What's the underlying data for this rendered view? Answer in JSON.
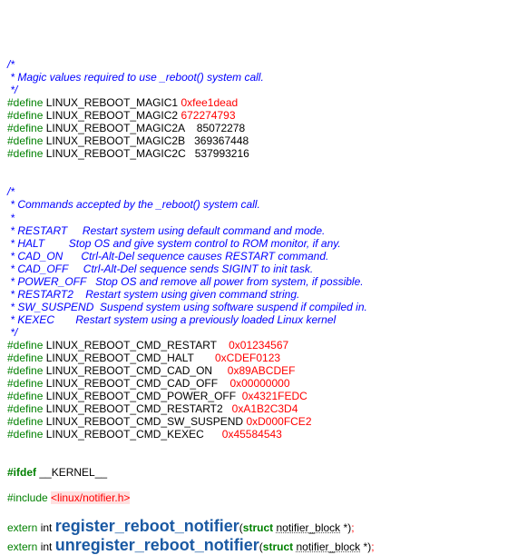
{
  "block1": {
    "c1": "/*",
    "c2": " * Magic values required to use _reboot() system call.",
    "c3": " */"
  },
  "defs1": [
    {
      "kw": "#define",
      "name": "LINUX_REBOOT_MAGIC1",
      "val": "0xfee1dead",
      "cls": "hex"
    },
    {
      "kw": "#define",
      "name": "LINUX_REBOOT_MAGIC2",
      "val": "672274793",
      "cls": "hex"
    },
    {
      "kw": "#define",
      "name": "LINUX_REBOOT_MAGIC2A    85072278",
      "val": "",
      "cls": "num"
    },
    {
      "kw": "#define",
      "name": "LINUX_REBOOT_MAGIC2B   369367448",
      "val": "",
      "cls": "num"
    },
    {
      "kw": "#define",
      "name": "LINUX_REBOOT_MAGIC2C   537993216",
      "val": "",
      "cls": "num"
    }
  ],
  "block2": {
    "c1": "/*",
    "c2": " * Commands accepted by the _reboot() system call.",
    "c3": " *",
    "c4": " * RESTART     Restart system using default command and mode.",
    "c5": " * HALT        Stop OS and give system control to ROM monitor, if any.",
    "c6": " * CAD_ON      Ctrl-Alt-Del sequence causes RESTART command.",
    "c7": " * CAD_OFF     Ctrl-Alt-Del sequence sends SIGINT to init task.",
    "c8": " * POWER_OFF   Stop OS and remove all power from system, if possible.",
    "c9": " * RESTART2    Restart system using given command string.",
    "c10": " * SW_SUSPEND  Suspend system using software suspend if compiled in.",
    "c11": " * KEXEC       Restart system using a previously loaded Linux kernel",
    "c12": " */"
  },
  "defs2": [
    {
      "kw": "#define",
      "name": "LINUX_REBOOT_CMD_RESTART   ",
      "val": "0x01234567"
    },
    {
      "kw": "#define",
      "name": "LINUX_REBOOT_CMD_HALT      ",
      "val": "0xCDEF0123"
    },
    {
      "kw": "#define",
      "name": "LINUX_REBOOT_CMD_CAD_ON    ",
      "val": "0x89ABCDEF"
    },
    {
      "kw": "#define",
      "name": "LINUX_REBOOT_CMD_CAD_OFF   ",
      "val": "0x00000000"
    },
    {
      "kw": "#define",
      "name": "LINUX_REBOOT_CMD_POWER_OFF ",
      "val": "0x4321FEDC"
    },
    {
      "kw": "#define",
      "name": "LINUX_REBOOT_CMD_RESTART2  ",
      "val": "0xA1B2C3D4"
    },
    {
      "kw": "#define",
      "name": "LINUX_REBOOT_CMD_SW_SUSPEND",
      "val": "0xD000FCE2"
    },
    {
      "kw": "#define",
      "name": "LINUX_REBOOT_CMD_KEXEC     ",
      "val": "0x45584543"
    }
  ],
  "ifdef": {
    "kw": "#ifdef",
    "name": "__KERNEL__"
  },
  "include": {
    "kw": "#include",
    "val": "<linux/notifier.h>"
  },
  "protos": [
    {
      "storage": "extern",
      "ret": "int",
      "fn": "register_reboot_notifier",
      "structkw": "struct",
      "type": "notifier_block",
      "star": "*",
      "semi": ";"
    },
    {
      "storage": "extern",
      "ret": "int",
      "fn": "unregister_reboot_notifier",
      "structkw": "struct",
      "type": "notifier_block",
      "star": "*",
      "semi": ";"
    }
  ]
}
